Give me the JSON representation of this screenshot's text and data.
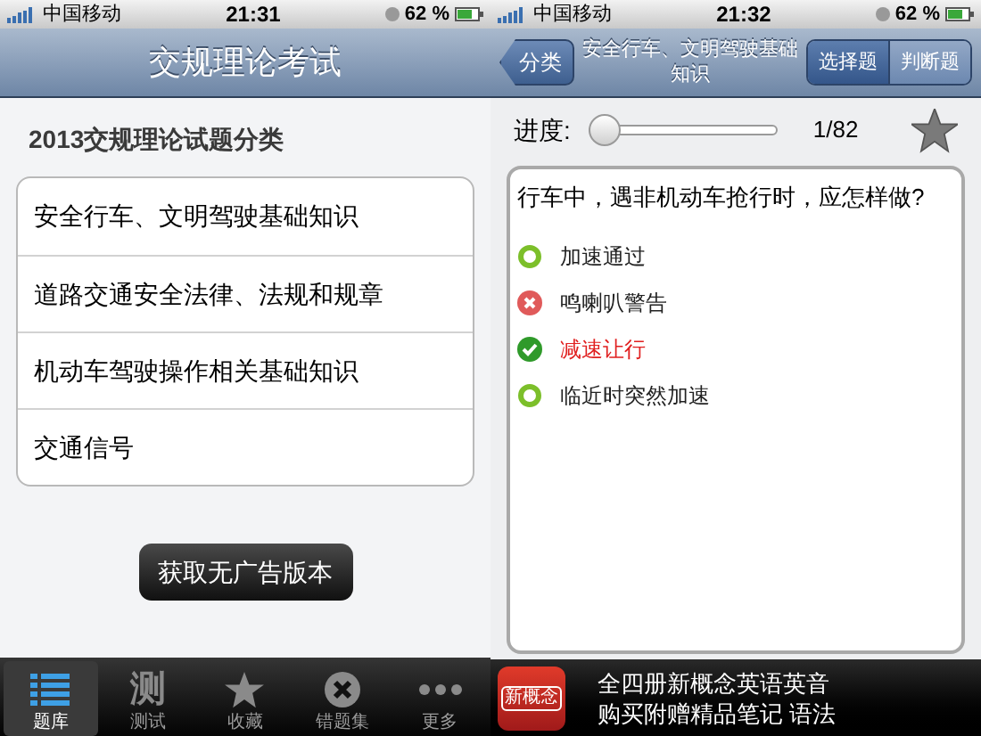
{
  "categories_screen": {
    "status_bar": {
      "carrier": "中国移动",
      "time": "21:31",
      "battery": "62 %"
    },
    "nav_bar": {
      "title": "交规理论考试"
    },
    "section_title": "2013交规理论试题分类",
    "categories": [
      {
        "label": "安全行车、文明驾驶基础知识"
      },
      {
        "label": "道路交通安全法律、法规和规章"
      },
      {
        "label": "机动车驾驶操作相关基础知识"
      },
      {
        "label": "交通信号"
      }
    ],
    "action_button": "获取无广告版本",
    "tab_bar": [
      {
        "label": "题库",
        "kind": "list",
        "selected": true
      },
      {
        "label": "测试",
        "kind": "glyph",
        "glyph": "测",
        "selected": false
      },
      {
        "label": "收藏",
        "kind": "star",
        "selected": false
      },
      {
        "label": "错题集",
        "kind": "cross",
        "selected": false
      },
      {
        "label": "更多",
        "kind": "dots",
        "selected": false
      }
    ]
  },
  "question_screen": {
    "status_bar": {
      "carrier": "中国移动",
      "time": "21:32",
      "battery": "62 %"
    },
    "nav_bar": {
      "back": "分类",
      "title": "安全行车、文明驾驶基础知识",
      "segments": [
        {
          "label": "选择题",
          "selected": true
        },
        {
          "label": "判断题",
          "selected": false
        }
      ]
    },
    "progress": {
      "label": "进度:",
      "level": 0,
      "reading": "1/82"
    },
    "question": "行车中，遇非机动车抢行时，应怎样做?",
    "options": [
      {
        "label": "加速通过",
        "kind": "none"
      },
      {
        "label": "鸣喇叭警告",
        "kind": "wrong"
      },
      {
        "label": "减速让行",
        "kind": "correct"
      },
      {
        "label": "临近时突然加速",
        "kind": "none"
      }
    ],
    "ad": {
      "icon_text": "新概念",
      "lines": [
        "全四册新概念英语英音",
        "购买附赠精品笔记 语法"
      ]
    }
  }
}
